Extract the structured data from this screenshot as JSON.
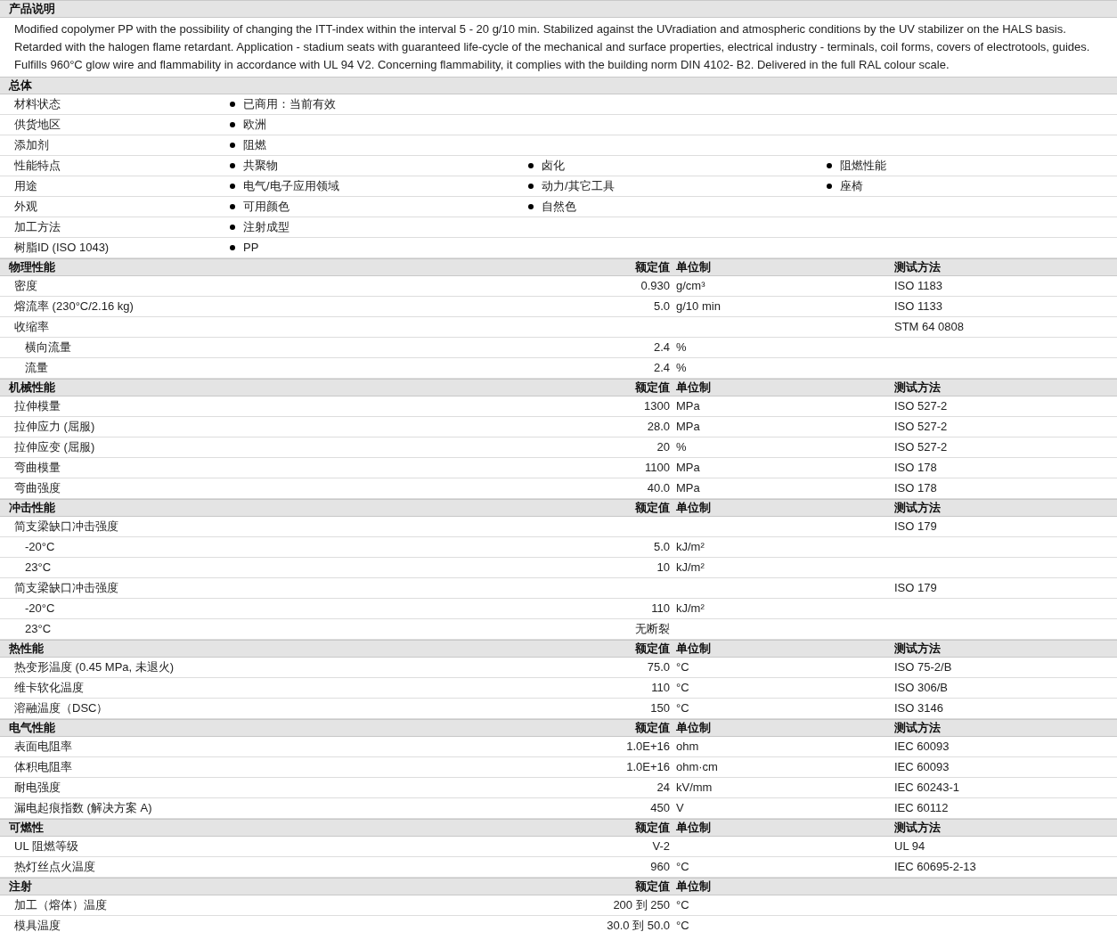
{
  "description": {
    "title": "产品说明",
    "lines": [
      "Modified copolymer PP with the possibility of changing the ITT-index within the interval 5 - 20 g/10 min. Stabilized against the UVradiation and atmospheric conditions by the UV stabilizer on the HALS basis.",
      "Retarded with the halogen flame retardant. Application - stadium seats with guaranteed life-cycle of the mechanical and surface properties, electrical industry - terminals, coil forms, covers of electrotools, guides.",
      "Fulfills 960°C glow wire and flammability in accordance with UL 94 V2. Concerning flammability, it complies with the building norm DIN 4102- B2. Delivered in the full RAL colour scale."
    ]
  },
  "general": {
    "title": "总体",
    "rows": [
      {
        "label": "材料状态",
        "items": [
          "已商用：当前有效"
        ]
      },
      {
        "label": "供货地区",
        "items": [
          "欧洲"
        ]
      },
      {
        "label": "添加剂",
        "items": [
          "阻燃"
        ]
      },
      {
        "label": "性能特点",
        "items": [
          "共聚物",
          "卤化",
          "阻燃性能"
        ]
      },
      {
        "label": "用途",
        "items": [
          "电气/电子应用领域",
          "动力/其它工具",
          "座椅"
        ]
      },
      {
        "label": "外观",
        "items": [
          "可用颜色",
          "自然色"
        ]
      },
      {
        "label": "加工方法",
        "items": [
          "注射成型"
        ]
      },
      {
        "label": "树脂ID (ISO 1043)",
        "items": [
          "PP"
        ]
      }
    ]
  },
  "sections": [
    {
      "title": "物理性能",
      "columns": [
        "额定值",
        "单位制",
        "测试方法"
      ],
      "rows": [
        {
          "kind": "main",
          "name": "密度",
          "value": "0.930",
          "unit": "g/cm³",
          "method": "ISO 1183"
        },
        {
          "kind": "main",
          "name": "熔流率  (230°C/2.16 kg)",
          "value": "5.0",
          "unit": "g/10 min",
          "method": "ISO 1133"
        },
        {
          "kind": "main",
          "name": "收缩率",
          "method": "STM 64 0808"
        },
        {
          "kind": "sub",
          "name": "横向流量",
          "value": "2.4",
          "unit": "%"
        },
        {
          "kind": "sub",
          "name": "流量",
          "value": "2.4",
          "unit": "%"
        }
      ]
    },
    {
      "title": "机械性能",
      "columns": [
        "额定值",
        "单位制",
        "测试方法"
      ],
      "rows": [
        {
          "kind": "main",
          "name": "拉伸模量",
          "value": "1300",
          "unit": "MPa",
          "method": "ISO 527-2"
        },
        {
          "kind": "main",
          "name": "拉伸应力  (屈服)",
          "value": "28.0",
          "unit": "MPa",
          "method": "ISO 527-2"
        },
        {
          "kind": "main",
          "name": "拉伸应变  (屈服)",
          "value": "20",
          "unit": "%",
          "method": "ISO 527-2"
        },
        {
          "kind": "main",
          "name": "弯曲模量",
          "value": "1100",
          "unit": "MPa",
          "method": "ISO 178"
        },
        {
          "kind": "main",
          "name": "弯曲强度",
          "value": "40.0",
          "unit": "MPa",
          "method": "ISO 178"
        }
      ]
    },
    {
      "title": "冲击性能",
      "columns": [
        "额定值",
        "单位制",
        "测试方法"
      ],
      "rows": [
        {
          "kind": "main",
          "name": "简支梁缺口冲击强度",
          "method": "ISO 179"
        },
        {
          "kind": "sub",
          "name": "-20°C",
          "value": "5.0",
          "unit": "kJ/m²"
        },
        {
          "kind": "sub",
          "name": "23°C",
          "value": "10",
          "unit": "kJ/m²"
        },
        {
          "kind": "main",
          "name": "简支梁缺口冲击强度",
          "method": "ISO 179"
        },
        {
          "kind": "sub",
          "name": "-20°C",
          "value": "110",
          "unit": "kJ/m²"
        },
        {
          "kind": "sub",
          "name": "23°C",
          "value": "无断裂"
        }
      ]
    },
    {
      "title": "热性能",
      "columns": [
        "额定值",
        "单位制",
        "测试方法"
      ],
      "rows": [
        {
          "kind": "main",
          "name": "热变形温度  (0.45 MPa, 未退火)",
          "value": "75.0",
          "unit": "°C",
          "method": "ISO 75-2/B"
        },
        {
          "kind": "main",
          "name": "维卡软化温度",
          "value": "110",
          "unit": "°C",
          "method": "ISO 306/B"
        },
        {
          "kind": "main",
          "name": "溶融温度（DSC）",
          "value": "150",
          "unit": "°C",
          "method": "ISO 3146"
        }
      ]
    },
    {
      "title": "电气性能",
      "columns": [
        "额定值",
        "单位制",
        "测试方法"
      ],
      "rows": [
        {
          "kind": "main",
          "name": "表面电阻率",
          "value": "1.0E+16",
          "unit": "ohm",
          "method": "IEC 60093"
        },
        {
          "kind": "main",
          "name": "体积电阻率",
          "value": "1.0E+16",
          "unit": "ohm·cm",
          "method": "IEC 60093"
        },
        {
          "kind": "main",
          "name": "耐电强度",
          "value": "24",
          "unit": "kV/mm",
          "method": "IEC 60243-1"
        },
        {
          "kind": "main",
          "name": "漏电起痕指数  (解决方案  A)",
          "value": "450",
          "unit": "V",
          "method": "IEC 60112"
        }
      ]
    },
    {
      "title": "可燃性",
      "columns": [
        "额定值",
        "单位制",
        "测试方法"
      ],
      "rows": [
        {
          "kind": "main",
          "name": "UL 阻燃等级",
          "value": "V-2",
          "method": "UL 94"
        },
        {
          "kind": "main",
          "name": "热灯丝点火温度",
          "value": "960",
          "unit": "°C",
          "method": "IEC 60695-2-13"
        }
      ]
    },
    {
      "title": "注射",
      "columns": [
        "额定值",
        "单位制"
      ],
      "rows": [
        {
          "kind": "main",
          "name": "加工（熔体）温度",
          "value": "200 到  250",
          "unit": "°C"
        },
        {
          "kind": "main",
          "name": "模具温度",
          "value": "30.0 到  50.0",
          "unit": "°C"
        }
      ]
    }
  ]
}
